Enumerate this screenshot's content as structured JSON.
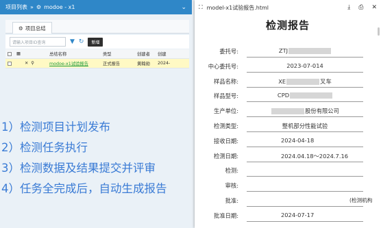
{
  "topbar": {
    "breadcrumb_root": "项目列表",
    "separator": "»",
    "project": "modoe - x1"
  },
  "tab": {
    "label": "项目总结"
  },
  "toolbar": {
    "search_placeholder": "请输入项目ID查询",
    "new_button": "新增"
  },
  "table": {
    "headers": [
      "",
      "",
      "",
      "",
      "总结名称",
      "类型",
      "创建者",
      "创建"
    ],
    "rows": [
      {
        "name": "modoe-x1试验报告",
        "type": "正式报告",
        "creator": "黄翰勋",
        "date": "2024-"
      }
    ]
  },
  "steps": [
    "1）检测项目计划发布",
    "2）检测任务执行",
    "3）检测数据及结果提交并评审",
    "4）任务全完成后，自动生成报告"
  ],
  "panel": {
    "filename": "model-x1试验报告.html",
    "doc_title": "检测报告",
    "fields": [
      {
        "label": "委托号:",
        "value_pre": "ZTJ",
        "value_post": "",
        "redacted": true,
        "align": "center"
      },
      {
        "label": "中心委托号:",
        "value_pre": "2023-07-014",
        "value_post": "",
        "redacted": false,
        "align": "center"
      },
      {
        "label": "样品名称:",
        "value_pre": "XE",
        "value_post": "叉车",
        "redacted": true,
        "align": "center"
      },
      {
        "label": "样品型号:",
        "value_pre": "CPD",
        "value_post": "",
        "redacted": true,
        "align": "center"
      },
      {
        "label": "生产单位:",
        "value_pre": "",
        "value_post": "股份有限公司",
        "redacted": true,
        "align": "center"
      },
      {
        "label": "检测类型:",
        "value_pre": "整机部分性能试验",
        "value_post": "",
        "redacted": false,
        "align": "center"
      },
      {
        "label": "接收日期:",
        "value_pre": "2024-04-18",
        "value_post": "",
        "redacted": false,
        "align": "left"
      },
      {
        "label": "检测日期:",
        "value_pre": "2024.04.18～2024.7.16",
        "value_post": "",
        "redacted": false,
        "align": "left"
      },
      {
        "label": "检测:",
        "value_pre": "",
        "value_post": "",
        "redacted": false,
        "align": "left"
      },
      {
        "label": "审核:",
        "value_pre": "",
        "value_post": "",
        "redacted": false,
        "align": "left"
      },
      {
        "label": "批准:",
        "value_pre": "",
        "value_post": "",
        "redacted": false,
        "align": "left",
        "extra": "(检测机构"
      },
      {
        "label": "批准日期:",
        "value_pre": "2024-07-17",
        "value_post": "",
        "redacted": false,
        "align": "left"
      }
    ]
  },
  "icons": {
    "page": "document-icon",
    "download": "download-icon",
    "print": "print-icon",
    "close": "close-icon",
    "search": "search-icon",
    "filter": "filter-icon",
    "refresh": "refresh-icon"
  },
  "colors": {
    "accent": "#2f87c8",
    "step_text": "#3a7bd5",
    "link": "#1b9a3a",
    "row_highlight": "#fff9c4"
  }
}
